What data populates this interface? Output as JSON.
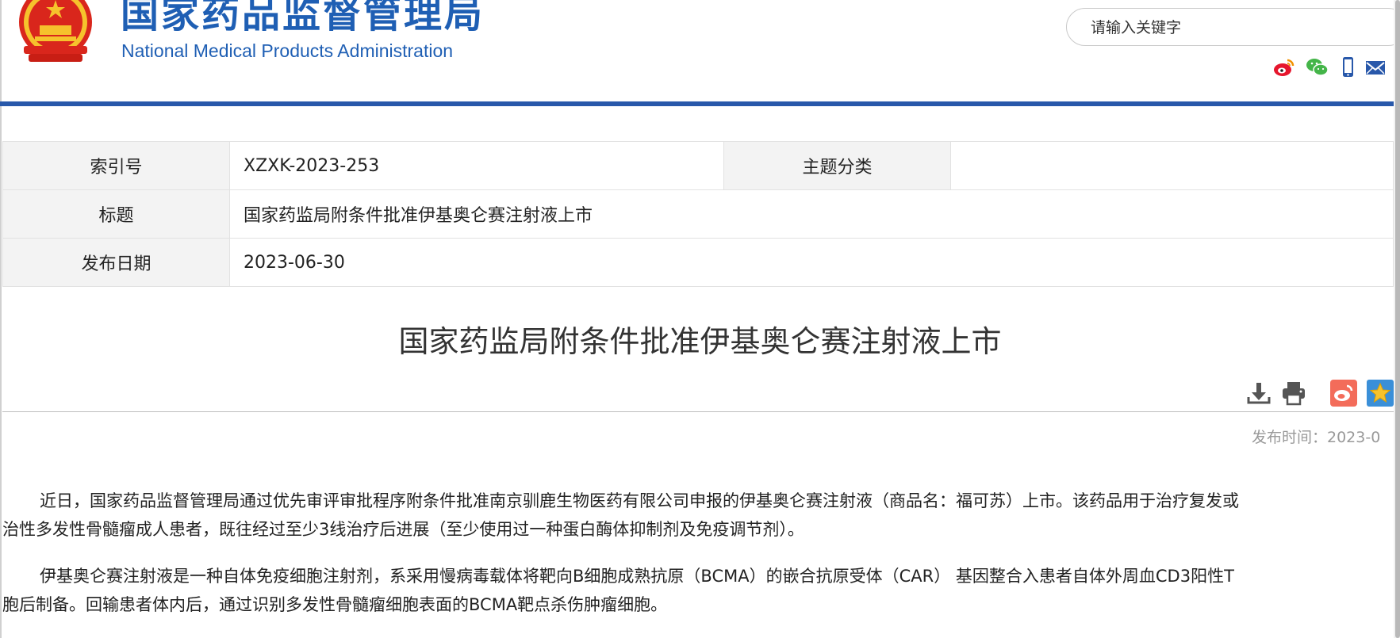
{
  "header": {
    "site_name_cn": "国家药品监督管理局",
    "site_name_en": "National Medical Products Administration",
    "search_placeholder": "请输入关键字"
  },
  "social_icons": [
    "weibo-icon",
    "wechat-icon",
    "mobile-icon",
    "mail-icon"
  ],
  "info_table": {
    "index_label": "索引号",
    "index_value": "XZXK-2023-253",
    "category_label": "主题分类",
    "category_value": "",
    "title_label": "标题",
    "title_value": "国家药监局附条件批准伊基奥仑赛注射液上市",
    "date_label": "发布日期",
    "date_value": "2023-06-30"
  },
  "article": {
    "title": "国家药监局附条件批准伊基奥仑赛注射液上市",
    "publish_time": "发布时间：2023-0",
    "tools": [
      "download-icon",
      "print-icon",
      "weibo-share-icon",
      "favorite-star-icon"
    ],
    "paragraphs": [
      {
        "line1": "近日，国家药品监督管理局通过优先审评审批程序附条件批准南京驯鹿生物医药有限公司申报的伊基奥仑赛注射液（商品名：福可苏）上市。该药品用于治疗复发或",
        "line2": "治性多发性骨髓瘤成人患者，既往经过至少3线治疗后进展（至少使用过一种蛋白酶体抑制剂及免疫调节剂）。"
      },
      {
        "line1": "伊基奥仑赛注射液是一种自体免疫细胞注射剂，系采用慢病毒载体将靶向B细胞成熟抗原（BCMA）的嵌合抗原受体（CAR） 基因整合入患者自体外周血CD3阳性T",
        "line2": "胞后制备。回输患者体内后，通过识别多发性骨髓瘤细胞表面的BCMA靶点杀伤肿瘤细胞。"
      }
    ]
  },
  "colors": {
    "brand_blue": "#1f5fb4",
    "rule_blue": "#2858aa",
    "emblem_red": "#d9261c",
    "emblem_gold": "#f6c22c"
  }
}
